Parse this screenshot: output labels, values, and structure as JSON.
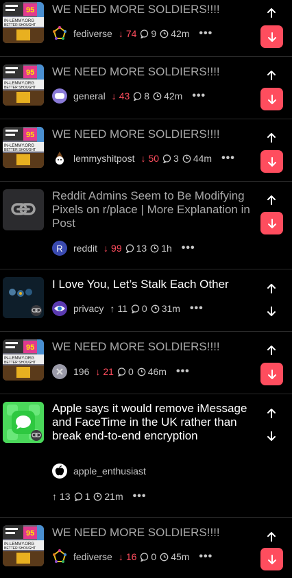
{
  "posts": [
    {
      "title": "WE NEED MORE SOLDIERS!!!!",
      "community": "fediverse",
      "vote_dir": "down",
      "score": "74",
      "comments": "9",
      "time": "42m",
      "read": true
    },
    {
      "title": "WE NEED MORE SOLDIERS!!!!",
      "community": "general",
      "vote_dir": "down",
      "score": "43",
      "comments": "8",
      "time": "42m",
      "read": true
    },
    {
      "title": "WE NEED MORE SOLDIERS!!!!",
      "community": "lemmyshitpost",
      "vote_dir": "down",
      "score": "50",
      "comments": "3",
      "time": "44m",
      "read": true
    },
    {
      "title": "Reddit Admins Seem to Be Modifying Pixels on r/place | More Explanation in Post",
      "community": "reddit",
      "vote_dir": "down",
      "score": "99",
      "comments": "13",
      "time": "1h",
      "read": true
    },
    {
      "title": "I Love You, Let’s Stalk Each Other",
      "community": "privacy",
      "vote_dir": "up",
      "score": "11",
      "comments": "0",
      "time": "31m",
      "read": false
    },
    {
      "title": "WE NEED MORE SOLDIERS!!!!",
      "community": "196",
      "vote_dir": "down",
      "score": "21",
      "comments": "0",
      "time": "46m",
      "read": true
    },
    {
      "title": "Apple says it would remove iMessage and FaceTime in the UK rather than break end-to-end encryption",
      "community": "apple_enthusiast",
      "vote_dir": "up",
      "score": "13",
      "comments": "1",
      "time": "21m",
      "read": false
    },
    {
      "title": "WE NEED MORE SOLDIERS!!!!",
      "community": "fediverse",
      "vote_dir": "down",
      "score": "16",
      "comments": "0",
      "time": "45m",
      "read": true
    }
  ],
  "community_icons": {
    "fediverse": "fediverse-icon",
    "general": "general-icon",
    "lemmyshitpost": "lemmyshitpost-icon",
    "reddit_letter": "R",
    "privacy": "eye-icon",
    "196": "196-icon",
    "apple_enthusiast": "apple-icon"
  },
  "meme_text": {
    "badge": "95",
    "line1": "IN-LEMMY.ORG",
    "line2": "BETTER SHOUGHT"
  },
  "colors": {
    "accent": "#ff4d5e",
    "text_read": "#a9a9a9",
    "meta": "#c8c8c8",
    "bg": "#000000"
  }
}
